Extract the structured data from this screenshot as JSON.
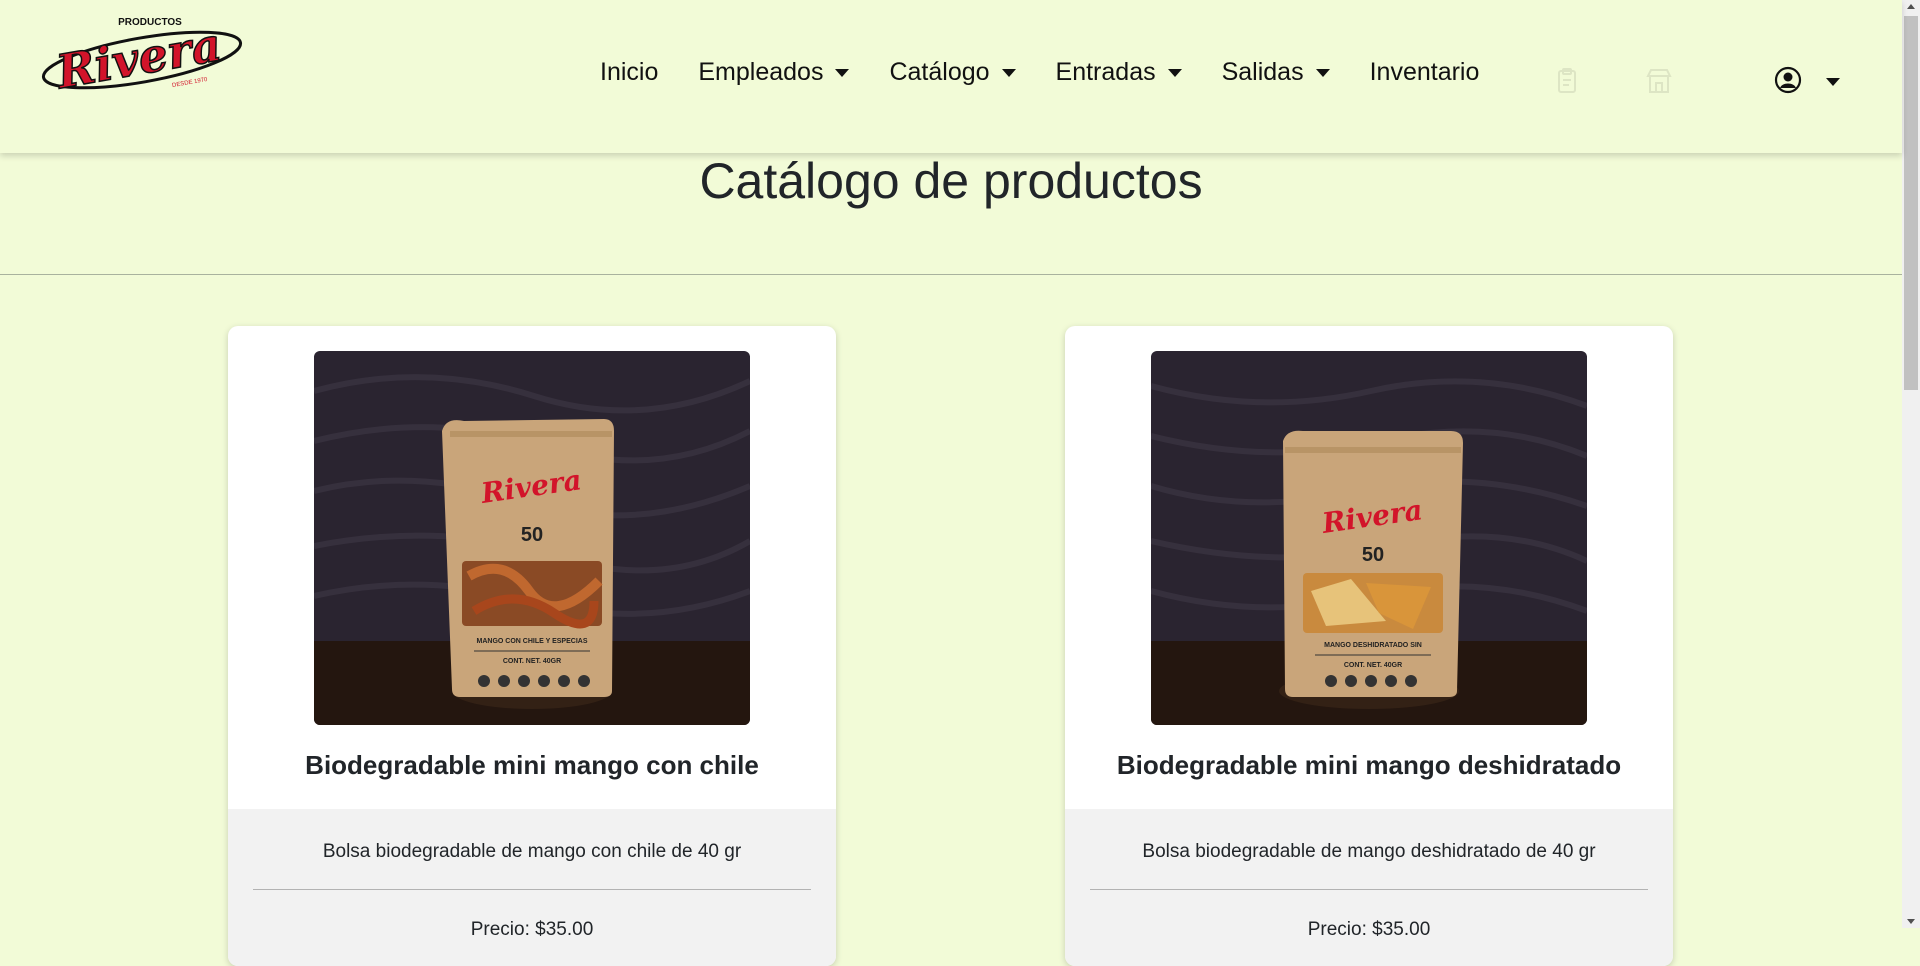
{
  "brand": {
    "top_text": "PRODUCTOS",
    "name": "Rivera",
    "tagline": "DESDE 1970",
    "colors": {
      "red": "#d2142a",
      "black": "#111111"
    }
  },
  "nav": {
    "items": [
      {
        "label": "Inicio",
        "dropdown": false
      },
      {
        "label": "Empleados",
        "dropdown": true
      },
      {
        "label": "Catálogo",
        "dropdown": true
      },
      {
        "label": "Entradas",
        "dropdown": true
      },
      {
        "label": "Salidas",
        "dropdown": true
      },
      {
        "label": "Inventario",
        "dropdown": false
      }
    ],
    "icons": [
      "clipboard-icon",
      "store-icon",
      "user-circle-icon"
    ]
  },
  "page": {
    "title": "Catálogo de productos"
  },
  "products": [
    {
      "title": "Biodegradable mini mango con chile",
      "description": "Bolsa biodegradable de mango con chile de 40 gr",
      "price": "Precio: $35.00",
      "bag": {
        "brand": "Rivera",
        "number": "50",
        "label": "MANGO CON CHILE Y ESPECIAS",
        "net": "CONT. NET. 40GR"
      }
    },
    {
      "title": "Biodegradable mini mango deshidratado",
      "description": "Bolsa biodegradable de mango deshidratado de 40 gr",
      "price": "Precio: $35.00",
      "bag": {
        "brand": "Rivera",
        "number": "50",
        "label": "MANGO DESHIDRATADO SIN",
        "net": "CONT. NET. 40GR"
      }
    }
  ]
}
